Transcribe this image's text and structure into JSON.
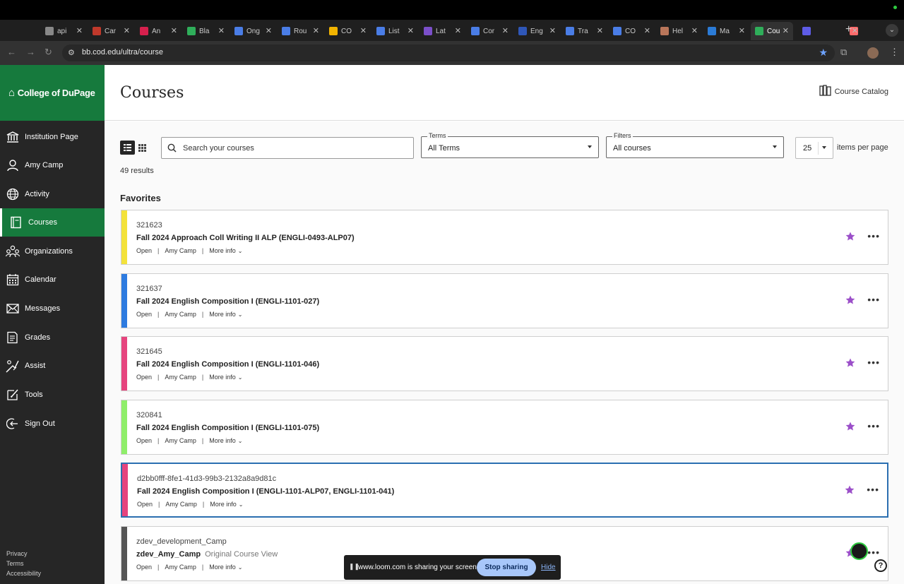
{
  "browser": {
    "tabs": [
      {
        "label": "api",
        "color": "#888888"
      },
      {
        "label": "Car",
        "color": "#c0392b"
      },
      {
        "label": "An",
        "color": "#d6204d"
      },
      {
        "label": "Bla",
        "color": "#2fae5a"
      },
      {
        "label": "Ong",
        "color": "#4a7de6"
      },
      {
        "label": "Rou",
        "color": "#4a7de6"
      },
      {
        "label": "CO",
        "color": "#f2b400"
      },
      {
        "label": "List",
        "color": "#4a7de6"
      },
      {
        "label": "Lat",
        "color": "#7b4fc9"
      },
      {
        "label": "Cor",
        "color": "#4a7de6"
      },
      {
        "label": "Eng",
        "color": "#2f57b8"
      },
      {
        "label": "Tra",
        "color": "#4a7de6"
      },
      {
        "label": "CO",
        "color": "#4a7de6"
      },
      {
        "label": "Hel",
        "color": "#b9765a"
      },
      {
        "label": "Ma",
        "color": "#2b7bd6"
      },
      {
        "label": "Cou",
        "color": "#2fae5a"
      },
      {
        "label": "",
        "color": "#5e5ce6"
      },
      {
        "label": "",
        "color": "#ff6b6b"
      }
    ],
    "url": "bb.cod.edu/ultra/course"
  },
  "sidebar": {
    "brand": "College of DuPage",
    "items": [
      {
        "label": "Institution Page",
        "icon": "institution-icon"
      },
      {
        "label": "Amy Camp",
        "icon": "user-icon"
      },
      {
        "label": "Activity",
        "icon": "globe-icon"
      },
      {
        "label": "Courses",
        "icon": "book-icon"
      },
      {
        "label": "Organizations",
        "icon": "organizations-icon"
      },
      {
        "label": "Calendar",
        "icon": "calendar-icon"
      },
      {
        "label": "Messages",
        "icon": "envelope-icon"
      },
      {
        "label": "Grades",
        "icon": "grades-icon"
      },
      {
        "label": "Assist",
        "icon": "assist-icon"
      },
      {
        "label": "Tools",
        "icon": "tools-icon"
      },
      {
        "label": "Sign Out",
        "icon": "sign-out-icon"
      }
    ],
    "footer": [
      "Privacy",
      "Terms",
      "Accessibility"
    ]
  },
  "header": {
    "title": "Courses",
    "catalog_label": "Course Catalog"
  },
  "toolbar": {
    "search_placeholder": "Search your courses",
    "terms_label": "Terms",
    "terms_value": "All Terms",
    "filters_label": "Filters",
    "filters_value": "All courses",
    "per_page_value": "25",
    "per_page_label": "items per page",
    "results": "49 results"
  },
  "favorites_title": "Favorites",
  "courses": [
    {
      "id": "321623",
      "name": "Fall 2024 Approach Coll Writing II ALP (ENGLI-0493-ALP07)",
      "sub": "",
      "color": "#f3e23b"
    },
    {
      "id": "321637",
      "name": "Fall 2024 English Composition I (ENGLI-1101-027)",
      "sub": "",
      "color": "#2d7be0"
    },
    {
      "id": "321645",
      "name": "Fall 2024 English Composition I (ENGLI-1101-046)",
      "sub": "",
      "color": "#e6447e"
    },
    {
      "id": "320841",
      "name": "Fall 2024 English Composition I (ENGLI-1101-075)",
      "sub": "",
      "color": "#8fee6a"
    },
    {
      "id": "d2bb0fff-8fe1-41d3-99b3-2132a8a9d81c",
      "name": "Fall 2024 English Composition I (ENGLI-1101-ALP07, ENGLI-1101-041)",
      "sub": "",
      "color": "#e6447e"
    },
    {
      "id": "zdev_development_Camp",
      "name": "zdev_Amy_Camp",
      "sub": "Original Course View",
      "color": "#555555"
    }
  ],
  "course_meta": {
    "status": "Open",
    "instructor": "Amy Camp",
    "more_info": "More info"
  },
  "loom": {
    "message": "www.loom.com is sharing your screen.",
    "stop": "Stop sharing",
    "hide": "Hide"
  },
  "colors": {
    "brand_green": "#167a3d",
    "sidebar_bg": "#262626",
    "favorite_star": "#9b4fc9",
    "focus_border": "#2b6fb1"
  }
}
